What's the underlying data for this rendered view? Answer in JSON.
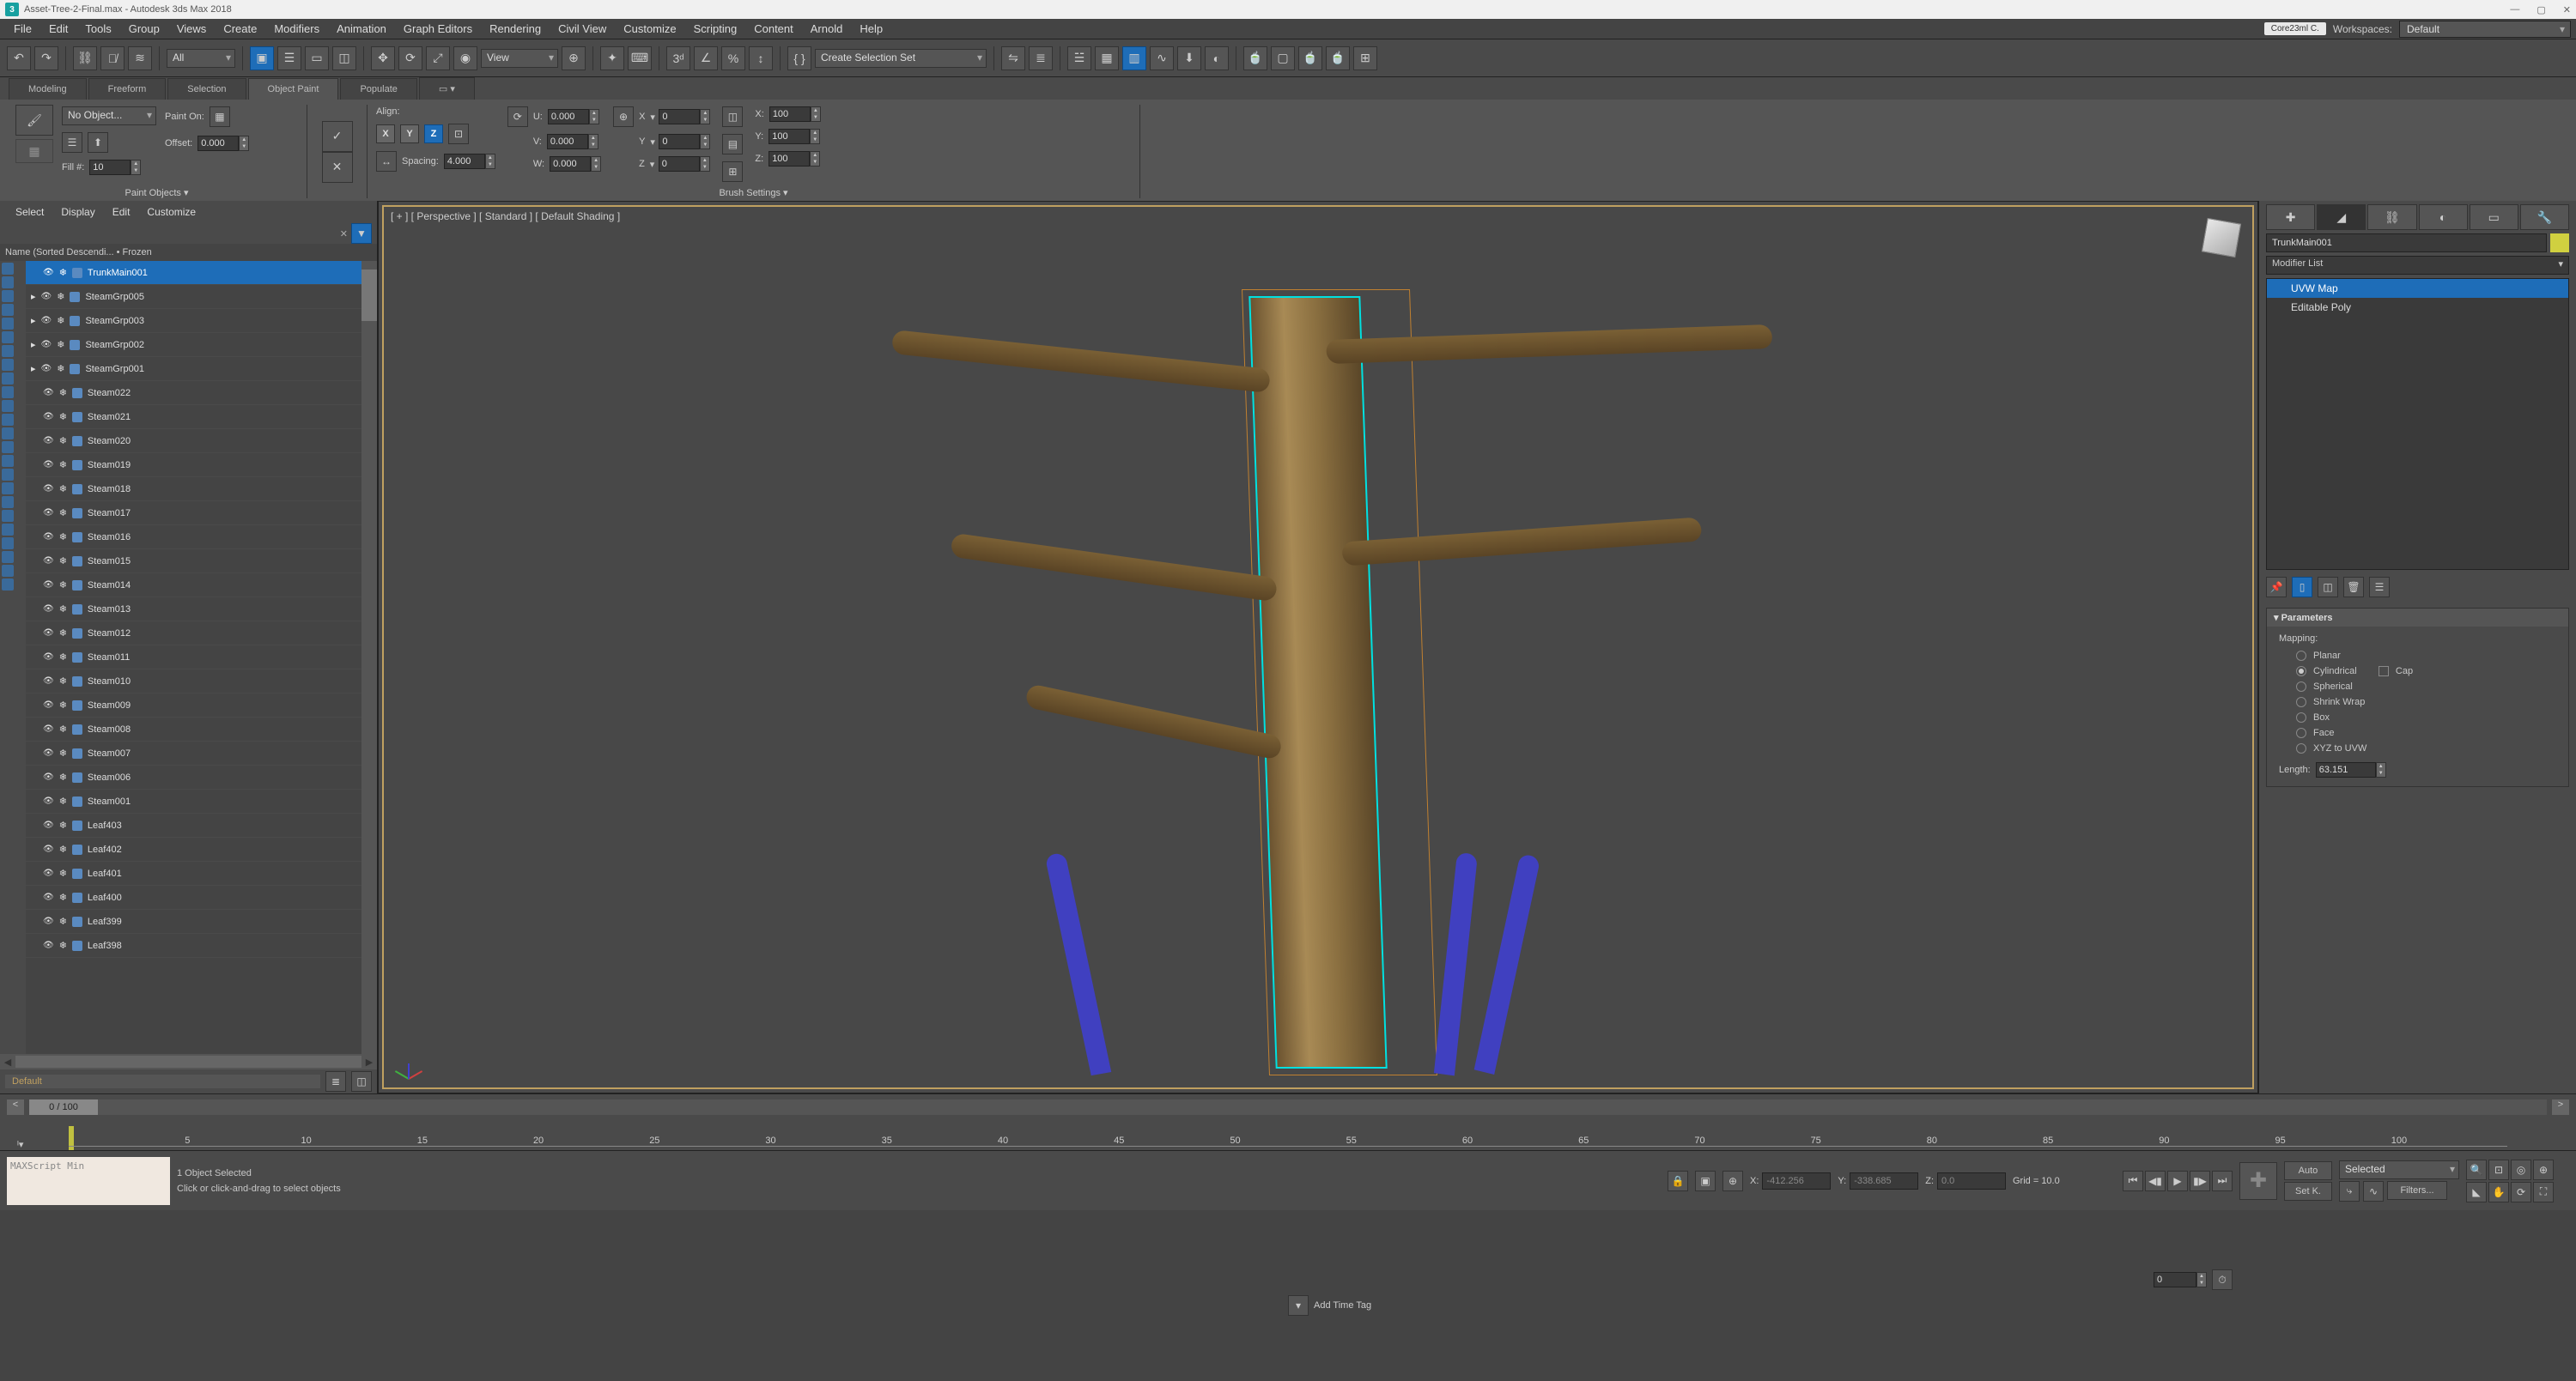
{
  "title": "Asset-Tree-2-Final.max - Autodesk 3ds Max 2018",
  "menu": [
    "File",
    "Edit",
    "Tools",
    "Group",
    "Views",
    "Create",
    "Modifiers",
    "Animation",
    "Graph Editors",
    "Rendering",
    "Civil View",
    "Customize",
    "Scripting",
    "Content",
    "Arnold",
    "Help"
  ],
  "user_badge": "Core23ml C.",
  "workspaces_label": "Workspaces:",
  "workspace": "Default",
  "toolbar": {
    "all_filter": "All",
    "view_drop": "View",
    "sel_set": "Create Selection Set"
  },
  "ribbon": {
    "tabs": [
      "Modeling",
      "Freeform",
      "Selection",
      "Object Paint",
      "Populate"
    ],
    "active": "Object Paint",
    "paint_objects": {
      "label": "Paint Objects",
      "no_obj": "No Object...",
      "paint_on": "Paint On:",
      "offset_lbl": "Offset:",
      "offset": "0.000",
      "fill_lbl": "Fill #:",
      "fill": "10"
    },
    "brush": {
      "label": "Brush Settings",
      "align": "Align:",
      "spacing_lbl": "Spacing:",
      "spacing": "4.000",
      "u_lbl": "U:",
      "u": "0.000",
      "v_lbl": "V:",
      "v": "0.000",
      "w_lbl": "W:",
      "w": "0.000",
      "x1_lbl": "X",
      "x1": "0",
      "y1_lbl": "Y",
      "y1": "0",
      "z1_lbl": "Z",
      "z1": "0",
      "x2_lbl": "X:",
      "x2": "100",
      "y2_lbl": "Y:",
      "y2": "100",
      "z2_lbl": "Z:",
      "z2": "100",
      "ax_x": "X",
      "ax_y": "Y",
      "ax_z": "Z"
    }
  },
  "scene_explorer": {
    "menu": [
      "Select",
      "Display",
      "Edit",
      "Customize"
    ],
    "header": "Name (Sorted Descendi... • Frozen",
    "items": [
      {
        "name": "TrunkMain001",
        "sel": true,
        "grp": false
      },
      {
        "name": "SteamGrp005",
        "grp": true
      },
      {
        "name": "SteamGrp003",
        "grp": true
      },
      {
        "name": "SteamGrp002",
        "grp": true
      },
      {
        "name": "SteamGrp001",
        "grp": true
      },
      {
        "name": "Steam022"
      },
      {
        "name": "Steam021"
      },
      {
        "name": "Steam020"
      },
      {
        "name": "Steam019"
      },
      {
        "name": "Steam018"
      },
      {
        "name": "Steam017"
      },
      {
        "name": "Steam016"
      },
      {
        "name": "Steam015"
      },
      {
        "name": "Steam014"
      },
      {
        "name": "Steam013"
      },
      {
        "name": "Steam012"
      },
      {
        "name": "Steam011"
      },
      {
        "name": "Steam010"
      },
      {
        "name": "Steam009"
      },
      {
        "name": "Steam008"
      },
      {
        "name": "Steam007"
      },
      {
        "name": "Steam006"
      },
      {
        "name": "Steam001"
      },
      {
        "name": "Leaf403"
      },
      {
        "name": "Leaf402"
      },
      {
        "name": "Leaf401"
      },
      {
        "name": "Leaf400"
      },
      {
        "name": "Leaf399"
      },
      {
        "name": "Leaf398"
      }
    ],
    "footer": "Default"
  },
  "viewport": {
    "label": "[ + ]  [ Perspective ]   [ Standard ]  [ Default Shading ]"
  },
  "command_panel": {
    "obj_name": "TrunkMain001",
    "modlist": "Modifier List",
    "stack": [
      "UVW Map",
      "Editable Poly"
    ],
    "rollout": "Parameters",
    "mapping_lbl": "Mapping:",
    "mapping": [
      "Planar",
      "Cylindrical",
      "Spherical",
      "Shrink Wrap",
      "Box",
      "Face",
      "XYZ to UVW"
    ],
    "mapping_sel": "Cylindrical",
    "cap": "Cap",
    "length_lbl": "Length:",
    "length": "63.151"
  },
  "time": {
    "frame": "0 / 100",
    "ticks": [
      "5",
      "10",
      "15",
      "20",
      "25",
      "30",
      "35",
      "40",
      "45",
      "50",
      "55",
      "60",
      "65",
      "70",
      "75",
      "80",
      "85",
      "90",
      "95",
      "100"
    ]
  },
  "status": {
    "maxscript": "MAXScript Min",
    "sel": "1 Object Selected",
    "hint": "Click or click-and-drag to select objects",
    "x_lbl": "X:",
    "x": "-412.256",
    "y_lbl": "Y:",
    "y": "-338.685",
    "z_lbl": "Z:",
    "z": "0.0",
    "grid": "Grid = 10.0",
    "tag": "Add Time Tag",
    "auto": "Auto",
    "setk": "Set K.",
    "selected": "Selected",
    "keyfilt": "Filters...",
    "frame0": "0"
  }
}
